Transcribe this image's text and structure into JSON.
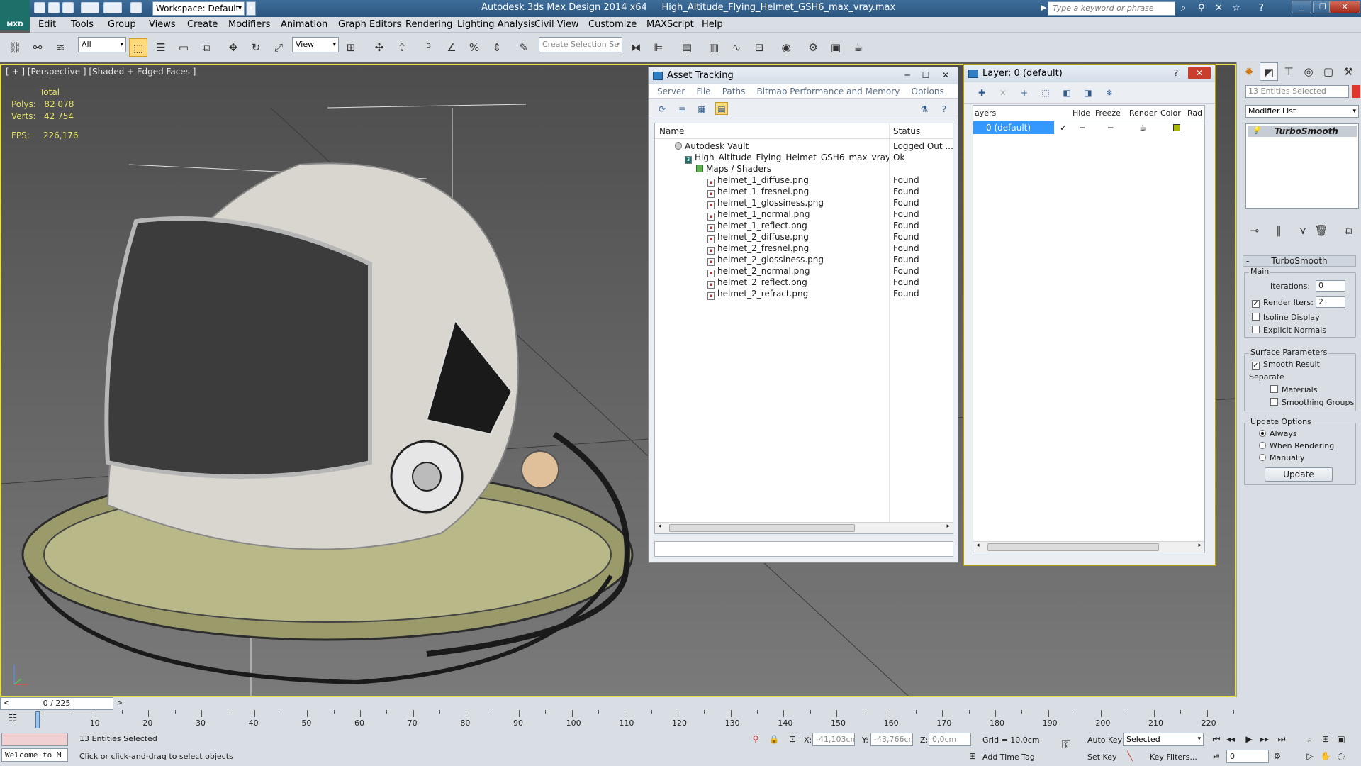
{
  "title_bar": {
    "logo": "MXD",
    "workspace": "Workspace: Default",
    "app_title": "Autodesk 3ds Max Design 2014 x64",
    "file_name": "High_Altitude_Flying_Helmet_GSH6_max_vray.max",
    "search_placeholder": "Type a keyword or phrase"
  },
  "menu": [
    "Edit",
    "Tools",
    "Group",
    "Views",
    "Create",
    "Modifiers",
    "Animation",
    "Graph Editors",
    "Rendering",
    "Lighting Analysis",
    "Civil View",
    "Customize",
    "MAXScript",
    "Help"
  ],
  "toolbar": {
    "selection_filter": "All",
    "ref_coord": "View",
    "selection_set": "Create Selection Se"
  },
  "viewport": {
    "label": "[ + ] [Perspective ] [Shaded + Edged Faces ]",
    "stats_total": "Total",
    "polys_label": "Polys:",
    "polys_value": "82 078",
    "verts_label": "Verts:",
    "verts_value": "42 754",
    "fps_label": "FPS:",
    "fps_value": "226,176"
  },
  "asset_tracking": {
    "title": "Asset Tracking",
    "menu": [
      "Server",
      "File",
      "Paths",
      "Bitmap Performance and Memory",
      "Options"
    ],
    "col_name": "Name",
    "col_status": "Status",
    "vault_name": "Autodesk Vault",
    "vault_status": "Logged Out ...",
    "file_name": "High_Altitude_Flying_Helmet_GSH6_max_vray.max",
    "file_status": "Ok",
    "folder": "Maps / Shaders",
    "assets": [
      {
        "name": "helmet_1_diffuse.png",
        "status": "Found"
      },
      {
        "name": "helmet_1_fresnel.png",
        "status": "Found"
      },
      {
        "name": "helmet_1_glossiness.png",
        "status": "Found"
      },
      {
        "name": "helmet_1_normal.png",
        "status": "Found"
      },
      {
        "name": "helmet_1_reflect.png",
        "status": "Found"
      },
      {
        "name": "helmet_2_diffuse.png",
        "status": "Found"
      },
      {
        "name": "helmet_2_fresnel.png",
        "status": "Found"
      },
      {
        "name": "helmet_2_glossiness.png",
        "status": "Found"
      },
      {
        "name": "helmet_2_normal.png",
        "status": "Found"
      },
      {
        "name": "helmet_2_reflect.png",
        "status": "Found"
      },
      {
        "name": "helmet_2_refract.png",
        "status": "Found"
      }
    ]
  },
  "layer_dialog": {
    "title": "Layer: 0 (default)",
    "columns": [
      "ayers",
      "Hide",
      "Freeze",
      "Render",
      "Color",
      "Rad"
    ],
    "layer_name": "0 (default)",
    "layer_color": "#a8b800"
  },
  "command_panel": {
    "selection": "13 Entities Selected",
    "modifier_list": "Modifier List",
    "stack_item": "TurboSmooth",
    "rollout_title": "TurboSmooth",
    "main_group": "Main",
    "iterations_label": "Iterations:",
    "iterations_value": "0",
    "render_iters_label": "Render Iters:",
    "render_iters_value": "2",
    "isoline": "Isoline Display",
    "explicit_normals": "Explicit Normals",
    "surface_group": "Surface Parameters",
    "smooth_result": "Smooth Result",
    "separate": "Separate",
    "materials": "Materials",
    "smoothing_groups": "Smoothing Groups",
    "update_group": "Update Options",
    "always": "Always",
    "when_rendering": "When Rendering",
    "manually": "Manually",
    "update_button": "Update",
    "accent": "#e0352b"
  },
  "timeline": {
    "frame": "0 / 225",
    "ticks": [
      "10",
      "20",
      "30",
      "40",
      "50",
      "60",
      "70",
      "80",
      "90",
      "100",
      "110",
      "120",
      "130",
      "140",
      "150",
      "160",
      "170",
      "180",
      "190",
      "200",
      "210",
      "220"
    ]
  },
  "status": {
    "maxscript": "Welcome to M",
    "selected": "13 Entities Selected",
    "prompt": "Click or click-and-drag to select objects",
    "x_label": "X:",
    "x_value": "-41,103cm",
    "y_label": "Y:",
    "y_value": "-43,766cm",
    "z_label": "Z:",
    "z_value": "0,0cm",
    "grid": "Grid = 10,0cm",
    "add_time_tag": "Add Time Tag",
    "auto_key": "Auto Key",
    "auto_key_value": "Selected",
    "set_key": "Set Key",
    "key_filters": "Key Filters...",
    "current_frame": "0"
  }
}
